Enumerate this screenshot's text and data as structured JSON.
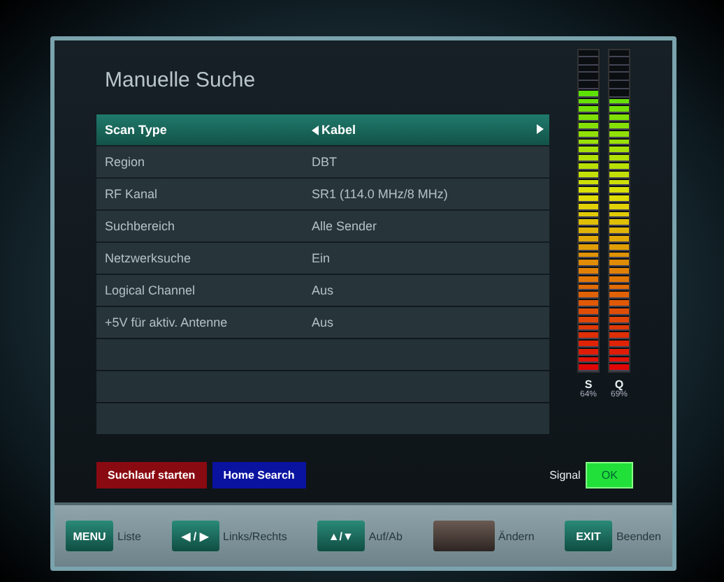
{
  "title": "Manuelle Suche",
  "settings": [
    {
      "label": "Scan Type",
      "value": "Kabel",
      "selected": true
    },
    {
      "label": "Region",
      "value": "DBT",
      "selected": false
    },
    {
      "label": "RF Kanal",
      "value": "SR1 (114.0 MHz/8 MHz)",
      "selected": false
    },
    {
      "label": "Suchbereich",
      "value": "Alle Sender",
      "selected": false
    },
    {
      "label": "Netzwerksuche",
      "value": "Ein",
      "selected": false
    },
    {
      "label": "Logical Channel",
      "value": "Aus",
      "selected": false
    },
    {
      "label": "+5V für aktiv. Antenne",
      "value": "Aus",
      "selected": false
    }
  ],
  "actions": [
    {
      "label": "Suchlauf starten",
      "color": "#8a0a12"
    },
    {
      "label": "Home Search",
      "color": "#0a12a0"
    }
  ],
  "meters": [
    {
      "name": "S",
      "level": 0.87,
      "reading": "64%"
    },
    {
      "name": "Q",
      "level": 0.85,
      "reading": "69%"
    }
  ],
  "signal": {
    "label": "Signal",
    "status": "OK"
  },
  "footer": [
    {
      "key": "MENU",
      "label": "Liste",
      "kind": "green"
    },
    {
      "key": "◀ / ▶",
      "label": "Links/Rechts",
      "kind": "green"
    },
    {
      "key": "▲/▼",
      "label": "Auf/Ab",
      "kind": "green"
    },
    {
      "label": "Ändern",
      "kind": "brown"
    },
    {
      "key": "EXIT",
      "label": "Beenden",
      "kind": "green"
    }
  ]
}
